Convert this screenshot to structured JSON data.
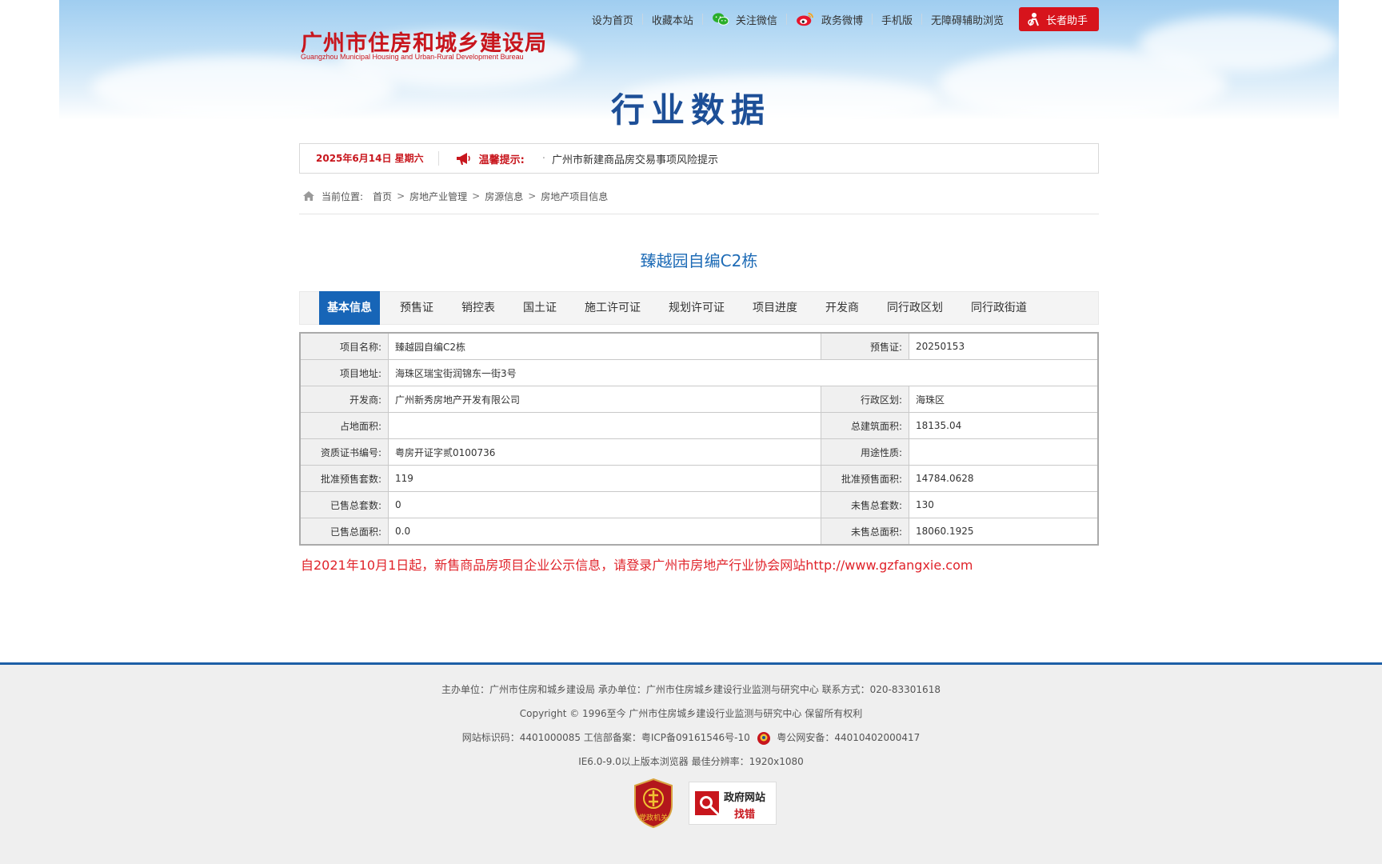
{
  "header": {
    "logo_cn": "广州市住房和城乡建设局",
    "logo_en": "Guangzhou Municipal Housing and Urban-Rural Development Bureau",
    "links": {
      "set_home": "设为首页",
      "favorite": "收藏本站",
      "wechat": "关注微信",
      "weibo": "政务微博",
      "mobile": "手机版",
      "accessibility": "无障碍辅助浏览"
    },
    "elder_button": "长者助手"
  },
  "page_title": "行业数据",
  "notice": {
    "date": "2025年6月14日 星期六",
    "tip_label": "温馨提示:",
    "message": "广州市新建商品房交易事项风险提示"
  },
  "breadcrumb": {
    "prefix": "当前位置:",
    "items": [
      "首页",
      "房地产业管理",
      "房源信息",
      "房地产项目信息"
    ],
    "sep": ">"
  },
  "project_title": "臻越园自编C2栋",
  "tabs": [
    "基本信息",
    "预售证",
    "销控表",
    "国土证",
    "施工许可证",
    "规划许可证",
    "项目进度",
    "开发商",
    "同行政区划",
    "同行政街道"
  ],
  "info": {
    "project_name_label": "项目名称:",
    "project_name": "臻越园自编C2栋",
    "presale_label": "预售证:",
    "presale": "20250153",
    "address_label": "项目地址:",
    "address": "海珠区瑞宝街润锦东一街3号",
    "developer_label": "开发商:",
    "developer": "广州新秀房地产开发有限公司",
    "district_label": "行政区划:",
    "district": "海珠区",
    "land_area_label": "占地面积:",
    "land_area": "",
    "total_area_label": "总建筑面积:",
    "total_area": "18135.04",
    "cert_no_label": "资质证书编号:",
    "cert_no": "粤房开证字贰0100736",
    "usage_label": "用途性质:",
    "usage": "",
    "approved_units_label": "批准预售套数:",
    "approved_units": "119",
    "approved_area_label": "批准预售面积:",
    "approved_area": "14784.0628",
    "sold_units_label": "已售总套数:",
    "sold_units": "0",
    "unsold_units_label": "未售总套数:",
    "unsold_units": "130",
    "sold_area_label": "已售总面积:",
    "sold_area": "0.0",
    "unsold_area_label": "未售总面积:",
    "unsold_area": "18060.1925"
  },
  "warning": "自2021年10月1日起，新售商品房项目企业公示信息，请登录广州市房地产行业协会网站http://www.gzfangxie.com",
  "footer": {
    "line1": "主办单位：广州市住房和城乡建设局 承办单位：广州市住房城乡建设行业监测与研究中心  联系方式：020-83301618",
    "line2": "Copyright © 1996至今 广州市住房城乡建设行业监测与研究中心 保留所有权利",
    "line3a": "网站标识码：4401000085 工信部备案：粤ICP备09161546号-10",
    "line3b": "粤公网安备：44010402000417",
    "line4": "IE6.0-9.0以上版本浏览器 最佳分辨率：1920x1080",
    "badge1": "党政机关",
    "badge2_line1": "政府网站",
    "badge2_line2": "找错"
  },
  "colors": {
    "brand_red": "#c8161d",
    "brand_blue": "#1d4f97",
    "tab_active": "#1765b7",
    "warning_red": "#e0232a"
  }
}
